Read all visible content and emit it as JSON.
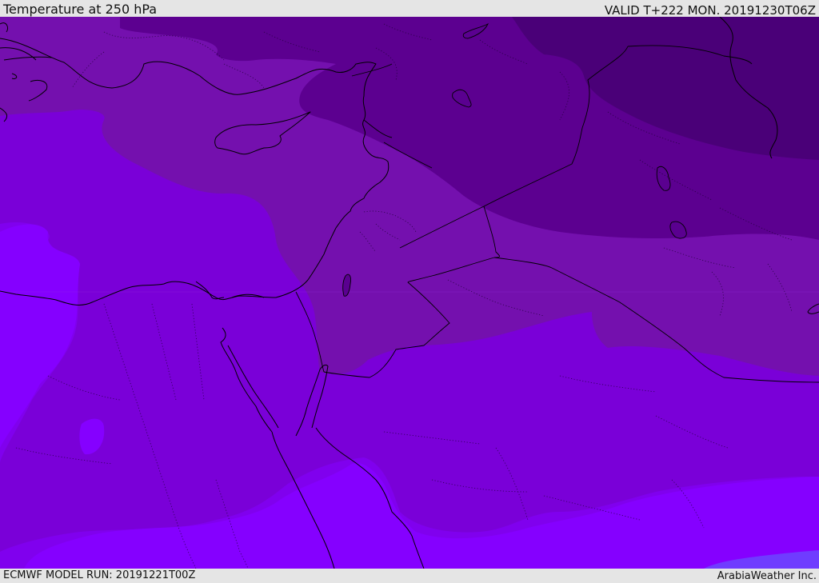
{
  "header": {
    "title": "Temperature at 250 hPa",
    "valid": "VALID T+222 MON. 20191230T06Z"
  },
  "footer": {
    "model_run": "ECMWF MODEL RUN: 20191221T00Z",
    "credit": "ArabiaWeather Inc."
  },
  "map": {
    "colors": {
      "coldest": "#4a0078",
      "very_cold": "#5c0090",
      "cold": "#7410ae",
      "mid": "#7a00d8",
      "warm": "#8000ee",
      "warmer": "#8500ff",
      "warmest": "#6f3cff",
      "lines": "#000000"
    }
  }
}
